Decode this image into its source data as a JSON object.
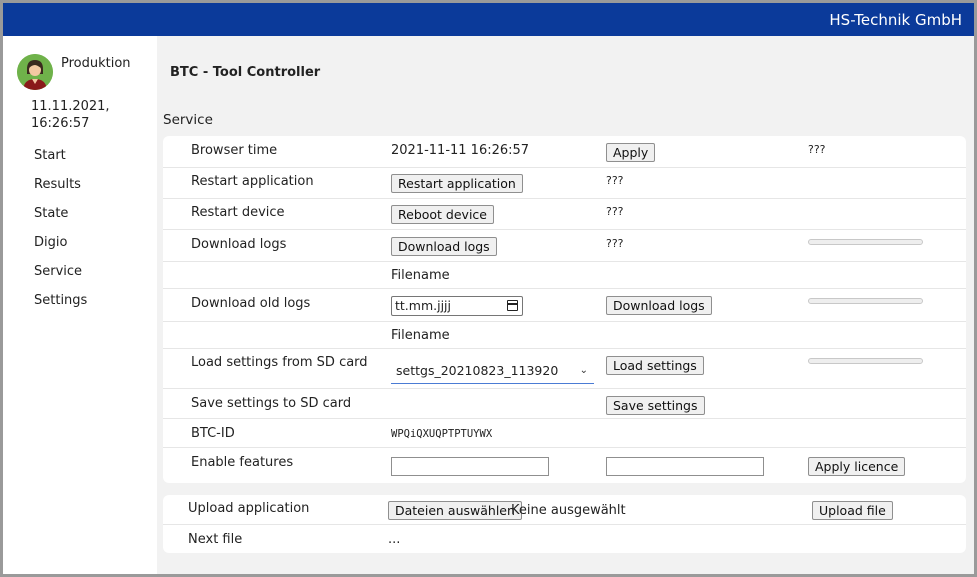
{
  "brand": "HS-Technik GmbH",
  "user": {
    "name": "Produktion",
    "date": "11.11.2021,",
    "time": "16:26:57"
  },
  "nav": [
    "Start",
    "Results",
    "State",
    "Digio",
    "Service",
    "Settings"
  ],
  "page": {
    "title": "BTC - Tool Controller",
    "section": "Service"
  },
  "service": {
    "browser_time": {
      "label": "Browser time",
      "value": "2021-11-11 16:26:57",
      "button": "Apply",
      "status": "???"
    },
    "restart_app": {
      "label": "Restart application",
      "button": "Restart application",
      "status": "???"
    },
    "restart_device": {
      "label": "Restart device",
      "button": "Reboot device",
      "status": "???"
    },
    "download_logs": {
      "label": "Download logs",
      "button": "Download logs",
      "status": "???",
      "progress": 0
    },
    "filename_label_1": "Filename",
    "download_old_logs": {
      "label": "Download old logs",
      "date_placeholder": "tt.mm.jjjj",
      "button": "Download logs",
      "progress": 0
    },
    "filename_label_2": "Filename",
    "load_settings": {
      "label": "Load settings from SD card",
      "selected": "settgs_20210823_113920",
      "button": "Load settings",
      "progress": 0
    },
    "save_settings": {
      "label": "Save settings to SD card",
      "button": "Save settings"
    },
    "btc_id": {
      "label": "BTC-ID",
      "value": "WPQiQXUQPTPTUYWX"
    },
    "features": {
      "label": "Enable features",
      "input1": "",
      "input2": "",
      "button": "Apply licence"
    }
  },
  "upload": {
    "label": "Upload application",
    "choose_button": "Dateien auswählen",
    "none_selected": "Keine ausgewählt",
    "upload_button": "Upload file",
    "next_label": "Next file",
    "next_value": "..."
  },
  "colors": {
    "topbar": "#0b3a9a",
    "avatar_bg": "#6fb24a",
    "select_underline": "#4a7bd4"
  }
}
